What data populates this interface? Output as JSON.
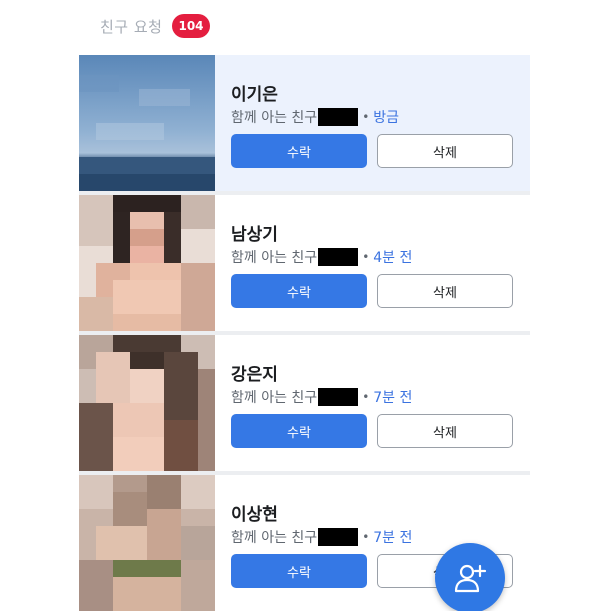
{
  "header": {
    "title": "친구 요청",
    "badge_count": "104",
    "badge_color": "#e41e3f"
  },
  "requests": [
    {
      "name": "이기은",
      "mutual_label": "함께 아는 친구",
      "separator": "•",
      "time": "방금",
      "accept_label": "수락",
      "delete_label": "삭제",
      "highlighted": true
    },
    {
      "name": "남상기",
      "mutual_label": "함께 아는 친구",
      "separator": "•",
      "time": "4분 전",
      "accept_label": "수락",
      "delete_label": "삭제",
      "highlighted": false
    },
    {
      "name": "강은지",
      "mutual_label": "함께 아는 친구",
      "separator": "•",
      "time": "7분 전",
      "accept_label": "수락",
      "delete_label": "삭제",
      "highlighted": false
    },
    {
      "name": "이상현",
      "mutual_label": "함께 아는 친구",
      "separator": "•",
      "time": "7분 전",
      "accept_label": "수락",
      "delete_label": "삭제",
      "highlighted": false
    }
  ],
  "fab": {
    "icon": "add-friend-icon",
    "color": "#2f78e4"
  },
  "colors": {
    "accent": "#3578e5",
    "time_text": "#3b73e0",
    "highlight_row": "#ecf2fd"
  }
}
